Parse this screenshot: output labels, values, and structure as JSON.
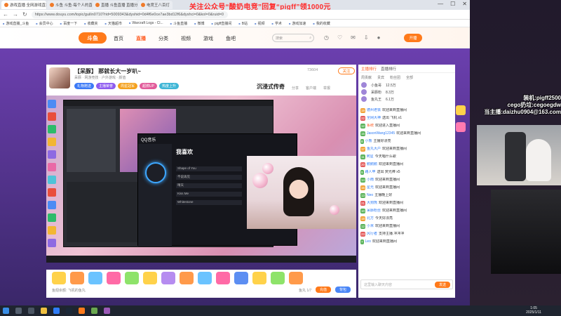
{
  "browser": {
    "tabs": [
      {
        "label": "游戏直播 全网游戏直播 斗鱼直播"
      },
      {
        "label": "斗鱼 斗鱼·每个人的直播平台"
      },
      {
        "label": "直播 斗鱼直播 直播分享"
      },
      {
        "label": "电竞王八百灯"
      }
    ],
    "url": "https://www.douyu.com/topic/guilin0710?rid=5009343&dyshid=0d4f6e0ce7ae3bd12f6&dyshci=0&kol=0&ruid=0",
    "bookmarks": [
      "游戏直播_斗鱼",
      "会员中心",
      "百度一下",
      "收藏夹",
      "天猫超市",
      "Warcraft Logs - Cl...",
      "斗鱼直播",
      "微博",
      "pigff直播间",
      "B站",
      "视频",
      "学术",
      "游戏加速",
      "我的收藏"
    ],
    "banner": "关注公众号“酸奶电竞”回复“pigff”领1000元"
  },
  "site": {
    "logo": "斗鱼",
    "nav": [
      "首页",
      "直播",
      "分类",
      "视频",
      "游戏",
      "鱼吧"
    ],
    "nav_active": "直播",
    "search_placeholder": "搜索",
    "open_label": "开播"
  },
  "room": {
    "title": "【呆豚】 那就长大一岁叭~",
    "meta": "呆豚 · 网游竞技 · 户外游戏 · 颜值",
    "badges": [
      {
        "text": "礼物赠送",
        "color": "#3c7af6"
      },
      {
        "text": "主播荣誉",
        "color": "#8e5cf0"
      },
      {
        "text": "周星冠军",
        "color": "#f4a11d"
      },
      {
        "text": "超燃UP",
        "color": "#e25c9b"
      },
      {
        "text": "热度上升",
        "color": "#3fb6d6"
      }
    ],
    "stamp": "沉浸式传奇",
    "follow": "关注",
    "popularity": "73604",
    "actions": [
      "分享",
      "客户端",
      "举报"
    ]
  },
  "screen": {
    "music_app": "QQ音乐",
    "playlist_title": "我喜欢",
    "tracks": [
      "Shape of You",
      "不说再见",
      "晴天",
      "Kiss Me",
      "Whitestone"
    ]
  },
  "gift_bar": {
    "note": "鱼翅余额: 飞机的鱼丸",
    "yuwan": "鱼丸 1/7",
    "recharge": "充值",
    "pay": "背包"
  },
  "chat": {
    "tabs": [
      "主播排行",
      "直播排行"
    ],
    "rank_tabs": [
      "周贡献",
      "贵宾",
      "粉丝团",
      "全部"
    ],
    "top_rank": [
      {
        "name": "小鱼哥",
        "value": "12.5万"
      },
      {
        "name": "呆豚粉",
        "value": "8.3万"
      },
      {
        "name": "鱼丸王",
        "value": "6.1万"
      }
    ],
    "messages": [
      {
        "lvl": "19",
        "cls": "o",
        "user": "德州老铁",
        "text": "欢迎来到直播间"
      },
      {
        "lvl": "22",
        "cls": "r",
        "user": "全网大神",
        "text": "送出 飞机 x1"
      },
      {
        "lvl": "12",
        "cls": "",
        "user": "系统",
        "text": "欢迎进入直播间",
        "sys": true
      },
      {
        "lvl": "15",
        "cls": "",
        "user": "JasonWang12345",
        "text": "欢迎来到直播间"
      },
      {
        "lvl": "8",
        "cls": "",
        "user": "小熊",
        "text": "主播好漂亮"
      },
      {
        "lvl": "17",
        "cls": "o",
        "user": "鱼丸大户",
        "text": "欢迎来到直播间"
      },
      {
        "lvl": "11",
        "cls": "",
        "user": "阿星",
        "text": "今天唱什么歌"
      },
      {
        "lvl": "20",
        "cls": "r",
        "user": "鹅鹅鹅",
        "text": "欢迎来到直播间"
      },
      {
        "lvl": "9",
        "cls": "",
        "user": "路人甲",
        "text": "送出 荧光棒 x5"
      },
      {
        "lvl": "14",
        "cls": "",
        "user": "小雨",
        "text": "欢迎来到直播间"
      },
      {
        "lvl": "16",
        "cls": "o",
        "user": "星光",
        "text": "欢迎来到直播间"
      },
      {
        "lvl": "13",
        "cls": "",
        "user": "Neo",
        "text": "主播晚上好"
      },
      {
        "lvl": "21",
        "cls": "r",
        "user": "大狗熊",
        "text": "欢迎来到直播间"
      },
      {
        "lvl": "10",
        "cls": "",
        "user": "呆豚粉丝",
        "text": "欢迎来到直播间"
      },
      {
        "lvl": "18",
        "cls": "o",
        "user": "北方",
        "text": "今天好漂亮"
      },
      {
        "lvl": "12",
        "cls": "",
        "user": "小米",
        "text": "欢迎来到直播间"
      },
      {
        "lvl": "23",
        "cls": "r",
        "user": "风行者",
        "text": "支持主播 冲冲冲"
      },
      {
        "lvl": "7",
        "cls": "",
        "user": "Leo",
        "text": "欢迎来到直播间"
      }
    ],
    "input_placeholder": "这里输入聊天内容",
    "send": "发送"
  },
  "overlay": {
    "promo": [
      "装机:pigff2500",
      "cego扔垃:cegoegdw",
      "当主播:daizhu0904@163.com"
    ]
  },
  "taskbar": {
    "time": "1:05",
    "date": "2025/1/11"
  }
}
